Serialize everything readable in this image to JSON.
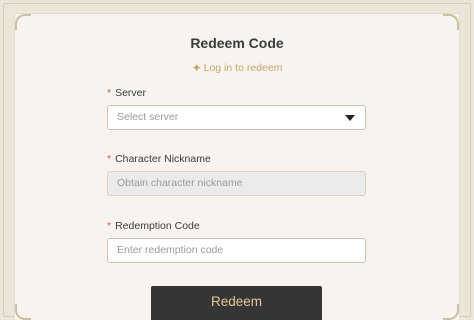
{
  "title": "Redeem Code",
  "login_link": {
    "icon": "sparkle-icon",
    "label": "Log in to redeem"
  },
  "server": {
    "label": "Server",
    "placeholder": "Select server",
    "value": ""
  },
  "nickname": {
    "label": "Character Nickname",
    "placeholder": "Obtain character nickname",
    "value": ""
  },
  "redemption_code": {
    "label": "Redemption Code",
    "placeholder": "Enter redemption code",
    "value": ""
  },
  "required_marker": "*",
  "redeem_button": "Redeem",
  "colors": {
    "accent_gold": "#c8a36a",
    "button_bg": "#353535",
    "button_text": "#e5c898",
    "required": "#d9534f"
  }
}
